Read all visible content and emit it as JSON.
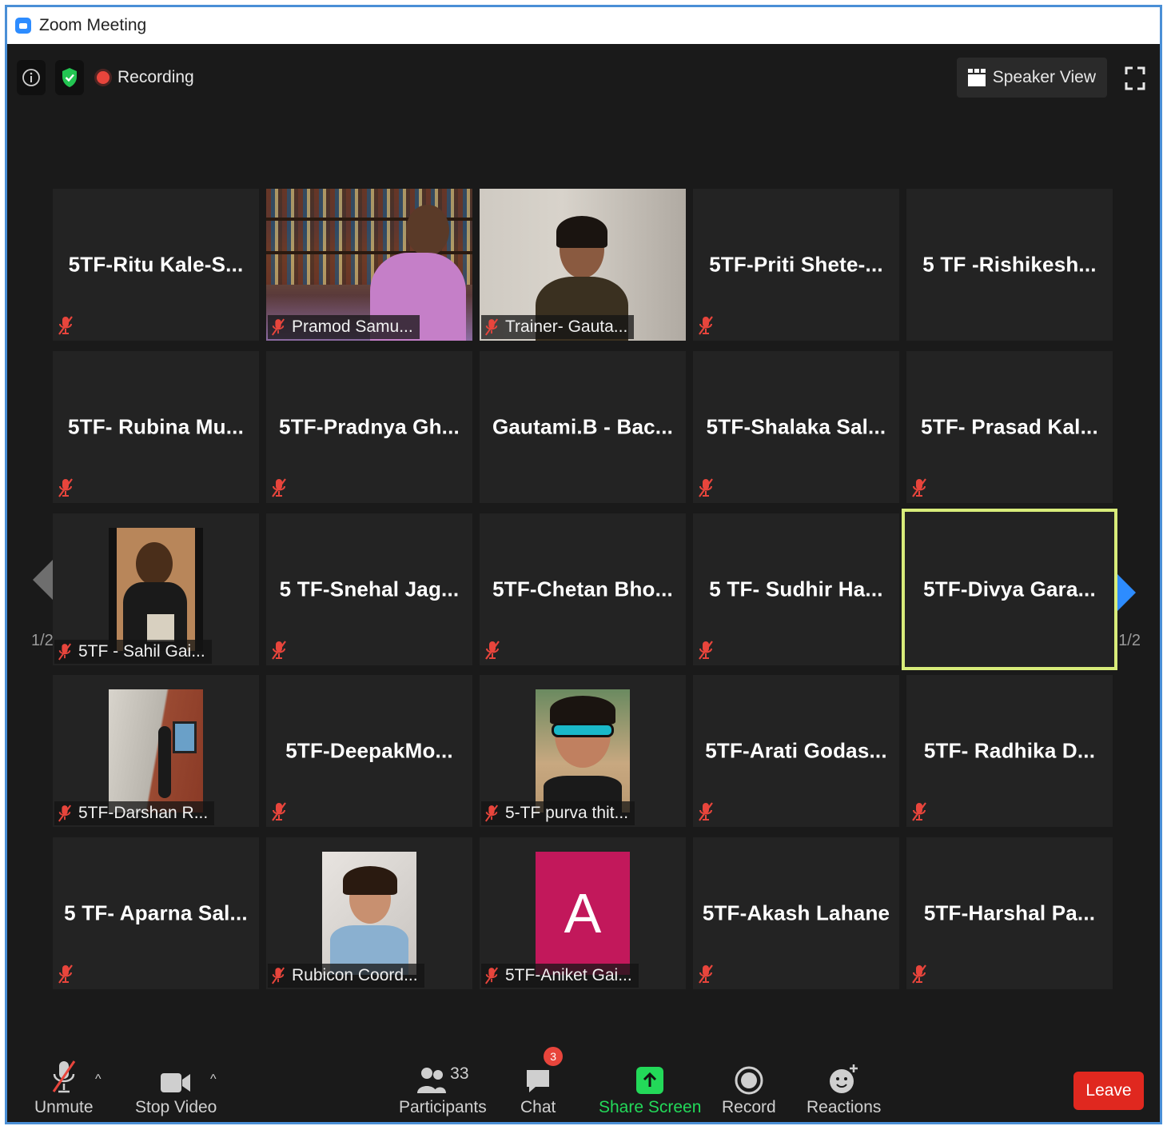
{
  "window": {
    "title": "Zoom Meeting"
  },
  "topbar": {
    "recording_label": "Recording",
    "speaker_view_label": "Speaker View"
  },
  "navigation": {
    "page_indicator_left": "1/2",
    "page_indicator_right": "1/2"
  },
  "tiles": [
    {
      "name": "5TF-Ritu Kale-S...",
      "video": false,
      "muted": true
    },
    {
      "name": "Pramod Samu...",
      "video": true,
      "muted": true
    },
    {
      "name": "Trainer- Gauta...",
      "video": true,
      "muted": true
    },
    {
      "name": "5TF-Priti Shete-...",
      "video": false,
      "muted": true
    },
    {
      "name": "5 TF -Rishikesh...",
      "video": false,
      "muted": false
    },
    {
      "name": "5TF- Rubina Mu...",
      "video": false,
      "muted": true
    },
    {
      "name": "5TF-Pradnya Gh...",
      "video": false,
      "muted": true
    },
    {
      "name": "Gautami.B - Bac...",
      "video": false,
      "muted": false
    },
    {
      "name": "5TF-Shalaka Sal...",
      "video": false,
      "muted": true
    },
    {
      "name": "5TF- Prasad Kal...",
      "video": false,
      "muted": true
    },
    {
      "name": "5TF - Sahil Gai...",
      "video": true,
      "muted": true
    },
    {
      "name": "5 TF-Snehal Jag...",
      "video": false,
      "muted": true
    },
    {
      "name": "5TF-Chetan Bho...",
      "video": false,
      "muted": true
    },
    {
      "name": "5 TF- Sudhir Ha...",
      "video": false,
      "muted": true
    },
    {
      "name": "5TF-Divya Gara...",
      "video": false,
      "muted": false,
      "active_speaker": true
    },
    {
      "name": "5TF-Darshan R...",
      "video": true,
      "muted": true
    },
    {
      "name": "5TF-DeepakMo...",
      "video": false,
      "muted": true
    },
    {
      "name": "5-TF purva thit...",
      "video": true,
      "muted": true
    },
    {
      "name": "5TF-Arati Godas...",
      "video": false,
      "muted": true
    },
    {
      "name": "5TF- Radhika D...",
      "video": false,
      "muted": true
    },
    {
      "name": "5 TF- Aparna Sal...",
      "video": false,
      "muted": true
    },
    {
      "name": "Rubicon Coord...",
      "video": true,
      "muted": true
    },
    {
      "name": "5TF-Aniket Gai...",
      "video": true,
      "muted": true,
      "avatar_letter": "A"
    },
    {
      "name": "5TF-Akash Lahane",
      "video": false,
      "muted": true
    },
    {
      "name": "5TF-Harshal Pa...",
      "video": false,
      "muted": true
    }
  ],
  "toolbar": {
    "unmute_label": "Unmute",
    "stop_video_label": "Stop Video",
    "participants_label": "Participants",
    "participants_count": "33",
    "chat_label": "Chat",
    "chat_badge": "3",
    "share_screen_label": "Share Screen",
    "record_label": "Record",
    "reactions_label": "Reactions",
    "leave_label": "Leave"
  },
  "colors": {
    "background": "#1a1a1a",
    "tile": "#232323",
    "active_speaker_border": "#d8ec7a",
    "share_screen_green": "#23d959",
    "leave_red": "#e0281f",
    "mute_red": "#e8453c",
    "next_arrow_blue": "#2d8cff",
    "avatar_pink": "#c2185b"
  }
}
